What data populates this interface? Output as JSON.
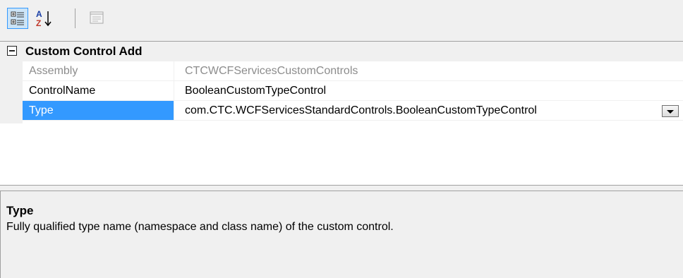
{
  "toolbar": {
    "buttons": [
      {
        "icon": "categorized-icon",
        "active": true
      },
      {
        "icon": "alphabetical-sort-icon",
        "active": false
      },
      {
        "icon": "property-pages-icon",
        "active": false,
        "disabled": true
      }
    ]
  },
  "grid": {
    "category": {
      "label": "Custom Control Add",
      "expanded": true,
      "properties": [
        {
          "name": "Assembly",
          "value": "CTCWCFServicesCustomControls",
          "readonly": true
        },
        {
          "name": "ControlName",
          "value": "BooleanCustomTypeControl",
          "readonly": false
        },
        {
          "name": "Type",
          "value": "com.CTC.WCFServicesStandardControls.BooleanCustomTypeControl",
          "readonly": false,
          "selected": true
        }
      ]
    }
  },
  "description": {
    "title": "Type",
    "text": "Fully qualified type name (namespace and class name) of the custom control."
  },
  "colors": {
    "selection": "#3399ff",
    "readonly_text": "#8c8c8c",
    "panel_background": "#f0f0f0"
  }
}
